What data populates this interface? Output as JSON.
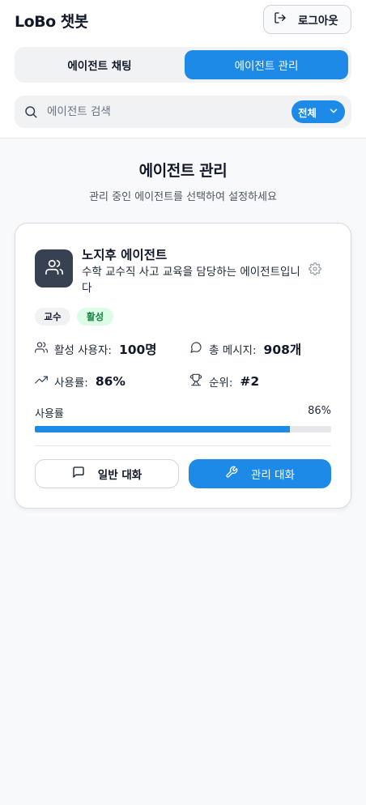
{
  "app": {
    "title": "LoBo 챗봇"
  },
  "header": {
    "logout_label": "로그아웃",
    "logout_icon": "logout-icon"
  },
  "tabs": [
    {
      "label": "에이전트 채팅",
      "active": false
    },
    {
      "label": "에이전트 관리",
      "active": true
    }
  ],
  "search": {
    "placeholder": "에이전트 검색",
    "value": "",
    "filter_selected": "전체"
  },
  "section": {
    "title": "에이전트 관리",
    "subtitle": "관리 중인 에이전트를 선택하여 설정하세요"
  },
  "agent": {
    "name": "노지후 에이전트",
    "description": "수학 교수직 사고 교육을 담당하는 에이전트입니다",
    "role_badge": "교수",
    "status_badge": "활성",
    "stats": {
      "active_users_label": "활성 사용자:",
      "active_users_value": "100명",
      "messages_label": "총 메시지:",
      "messages_value": "908개",
      "usage_label": "사용률:",
      "usage_value": "86%",
      "rank_label": "순위:",
      "rank_value": "#2"
    },
    "usage_bar_label": "사용률",
    "usage_bar_pct_text": "86%",
    "usage_fraction": 0.86,
    "chat_button": "일반 대화",
    "manage_button": "관리 대화"
  },
  "colors": {
    "accent": "#1d8ae8",
    "avatar_bg": "#374151",
    "status_bg": "#dcfce7",
    "status_text": "#15803d"
  }
}
